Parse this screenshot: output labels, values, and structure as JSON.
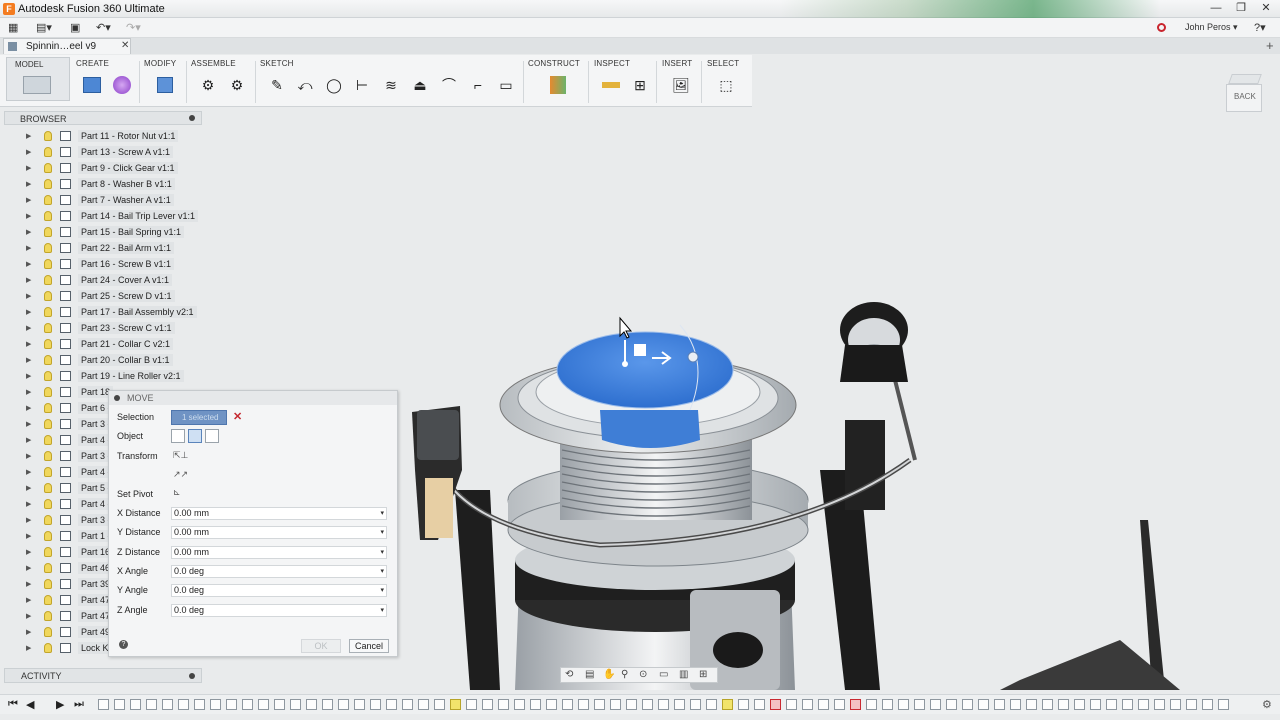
{
  "window": {
    "title": "Autodesk Fusion 360 Ultimate"
  },
  "user": {
    "name": "John Peros"
  },
  "document_tab": {
    "label": "Spinnin…eel v9"
  },
  "toolbar": {
    "workspace": "MODEL",
    "groups": [
      "CREATE",
      "MODIFY",
      "ASSEMBLE",
      "SKETCH",
      "CONSTRUCT",
      "INSPECT",
      "INSERT",
      "SELECT"
    ]
  },
  "viewcube": {
    "face_label": "BACK"
  },
  "browser": {
    "title": "BROWSER",
    "items": [
      "Part 11 - Rotor Nut v1:1",
      "Part 13 - Screw A v1:1",
      "Part 9 - Click Gear v1:1",
      "Part 8 - Washer B v1:1",
      "Part 7 - Washer A v1:1",
      "Part 14 - Bail Trip Lever v1:1",
      "Part 15 - Bail Spring v1:1",
      "Part 22 - Bail Arm v1:1",
      "Part 16 - Screw B v1:1",
      "Part 24 - Cover A v1:1",
      "Part 25 - Screw D v1:1",
      "Part 17 - Bail Assembly v2:1",
      "Part 23 - Screw C v1:1",
      "Part 21 - Collar C v2:1",
      "Part 20 - Collar B v1:1",
      "Part 19 - Line Roller v2:1",
      "Part 18",
      "Part 6 -",
      "Part 3 -",
      "Part 4 -",
      "Part 3 -",
      "Part 4 -",
      "Part 5 -",
      "Part 4 -",
      "Part 3 -",
      "Part 1 -",
      "Part 16",
      "Part 46",
      "Part 39",
      "Part 47",
      "Part 47",
      "Part 49",
      "Lock Ki"
    ]
  },
  "move_dialog": {
    "title": "MOVE",
    "selection_label": "Selection",
    "selection_value": "1 selected",
    "object_label": "Object",
    "transform_label": "Transform",
    "set_pivot_label": "Set Pivot",
    "fields": [
      {
        "label": "X Distance",
        "value": "0.00 mm"
      },
      {
        "label": "Y Distance",
        "value": "0.00 mm"
      },
      {
        "label": "Z Distance",
        "value": "0.00 mm"
      },
      {
        "label": "X Angle",
        "value": "0.0 deg"
      },
      {
        "label": "Y Angle",
        "value": "0.0 deg"
      },
      {
        "label": "Z Angle",
        "value": "0.0 deg"
      }
    ],
    "ok_label": "OK",
    "cancel_label": "Cancel"
  },
  "activity": {
    "title": "ACTIVITY"
  },
  "colors": {
    "selection_blue": "#3f7ed6",
    "accent": "#f47c20",
    "error_red": "#c4282f"
  }
}
